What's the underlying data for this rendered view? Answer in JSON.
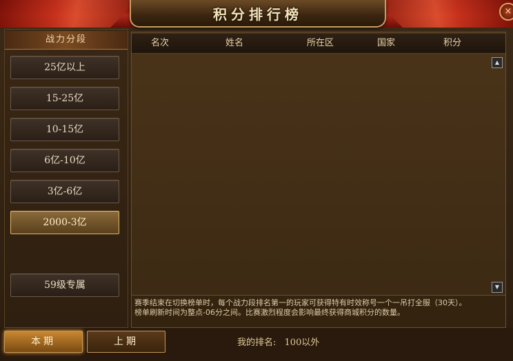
{
  "window": {
    "title": "积分排行榜",
    "close_glyph": "×"
  },
  "tiers": {
    "header": "战力分段",
    "items": [
      "25亿以上",
      "15-25亿",
      "10-15亿",
      "6亿-10亿",
      "3亿-6亿",
      "2000-3亿",
      "59级专属"
    ],
    "selected": "2000-3亿"
  },
  "table": {
    "columns": [
      "名次",
      "姓名",
      "所在区",
      "国家",
      "积分"
    ],
    "rows": []
  },
  "scroll": {
    "up_icon": "triangle-up-icon",
    "down_icon": "triangle-down-icon"
  },
  "notice": {
    "line1": "赛季结束在切换榜单时，每个战力段排名第一的玩家可获得特有时效称号一个一吊打全服（30天）。",
    "line2": "榜单刷新时间为整点-06分之间。比赛激烈程度会影响最终获得商城积分的数量。"
  },
  "bottom": {
    "current_label": "本期",
    "previous_label": "上期",
    "my_rank_label": "我的排名:",
    "my_rank_value": "100以外"
  },
  "colors": {
    "accent_gold": "#c89858",
    "active_tab": "#c88830",
    "panel_bg": "#4a3419"
  }
}
